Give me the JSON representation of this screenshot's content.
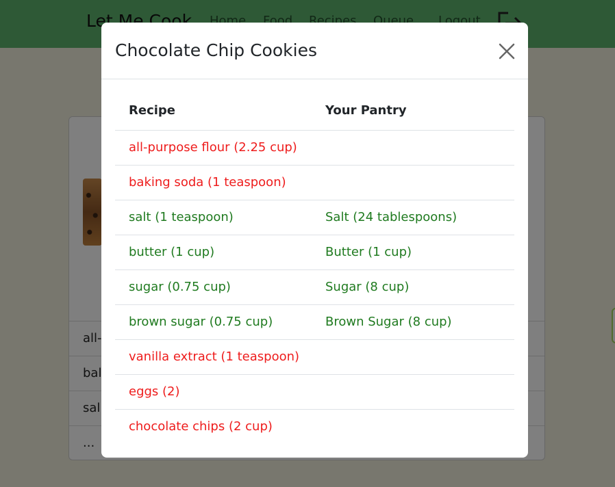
{
  "app": {
    "brand": "Let Me Cook",
    "nav": [
      "Home",
      "Food",
      "Recipes",
      "Queue",
      "Logout"
    ]
  },
  "card": {
    "rows": [
      "all-",
      "bal",
      "sal",
      "..."
    ]
  },
  "modal": {
    "title": "Chocolate Chip Cookies",
    "columns": [
      "Recipe",
      "Your Pantry"
    ],
    "rows": [
      {
        "recipe": "all-purpose flour (2.25 cup)",
        "pantry": "",
        "status": "missing"
      },
      {
        "recipe": "baking soda (1 teaspoon)",
        "pantry": "",
        "status": "missing"
      },
      {
        "recipe": "salt (1 teaspoon)",
        "pantry": "Salt (24 tablespoons)",
        "status": "have"
      },
      {
        "recipe": "butter (1 cup)",
        "pantry": "Butter (1 cup)",
        "status": "have"
      },
      {
        "recipe": "sugar (0.75 cup)",
        "pantry": "Sugar (8 cup)",
        "status": "have"
      },
      {
        "recipe": "brown sugar (0.75 cup)",
        "pantry": "Brown Sugar (8 cup)",
        "status": "have"
      },
      {
        "recipe": "vanilla extract (1 teaspoon)",
        "pantry": "",
        "status": "missing"
      },
      {
        "recipe": "eggs (2)",
        "pantry": "",
        "status": "missing"
      },
      {
        "recipe": "chocolate chips (2 cup)",
        "pantry": "",
        "status": "missing"
      }
    ]
  },
  "colors": {
    "navbar": "#5cb36d",
    "missing": "#ee1c1c",
    "have": "#1f7a1f"
  },
  "icons": {
    "logout": "logout-icon",
    "close": "close-icon"
  }
}
